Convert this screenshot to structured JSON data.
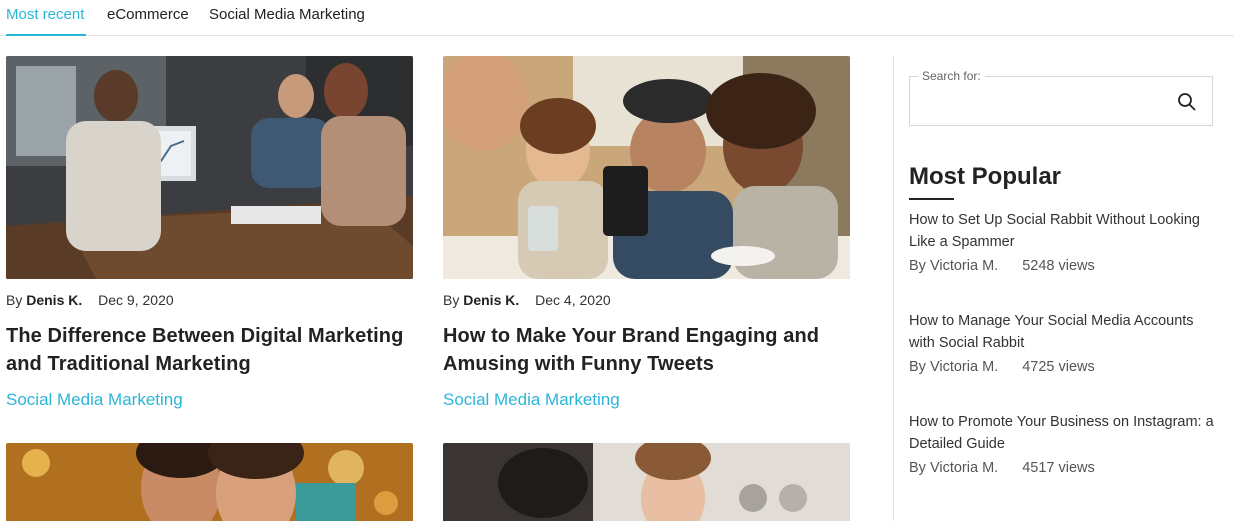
{
  "tabs": [
    {
      "label": "Most recent",
      "active": true
    },
    {
      "label": "eCommerce",
      "active": false
    },
    {
      "label": "Social Media Marketing",
      "active": false
    }
  ],
  "accent_color": "#2bb5d8",
  "posts": [
    {
      "by_prefix": "By",
      "author": "Denis K.",
      "date": "Dec 9, 2020",
      "title": "The Difference Between Digital Marketing and Traditional Marketing",
      "category": "Social Media Marketing",
      "image": "photo-team-meeting-laptop"
    },
    {
      "by_prefix": "By",
      "author": "Denis K.",
      "date": "Dec 4, 2020",
      "title": "How to Make Your Brand Engaging and Amusing with Funny Tweets",
      "category": "Social Media Marketing",
      "image": "photo-friends-looking-at-phone"
    }
  ],
  "partial_posts": [
    {
      "image": "photo-two-women-laughing"
    },
    {
      "image": "photo-woman-vlogging-camera"
    }
  ],
  "sidebar": {
    "search": {
      "label": "Search for:",
      "placeholder": "",
      "icon": "search-icon"
    },
    "popular_title": "Most Popular",
    "popular": [
      {
        "title": "How to Set Up Social Rabbit Without Looking Like a Spammer",
        "author": "By Victoria M.",
        "views": "5248 views"
      },
      {
        "title": "How to Manage Your Social Media Accounts with Social Rabbit",
        "author": "By Victoria M.",
        "views": "4725 views"
      },
      {
        "title": "How to Promote Your Business on Instagram: a Detailed Guide",
        "author": "By Victoria M.",
        "views": "4517 views"
      }
    ]
  }
}
